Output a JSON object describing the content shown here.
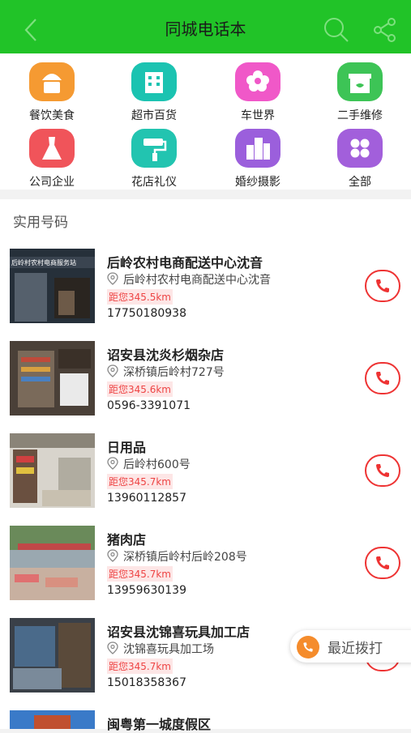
{
  "header": {
    "title": "同城电话本"
  },
  "categories": [
    {
      "label": "餐饮美食",
      "color": "#f59a32",
      "icon": "cupcake-icon"
    },
    {
      "label": "超市百货",
      "color": "#1bc3b1",
      "icon": "building-icon"
    },
    {
      "label": "车世界",
      "color": "#f058c8",
      "icon": "flower-icon"
    },
    {
      "label": "二手维修",
      "color": "#3dc456",
      "icon": "gift-icon"
    },
    {
      "label": "公司企业",
      "color": "#f0545a",
      "icon": "dress-icon"
    },
    {
      "label": "花店礼仪",
      "color": "#22c4b0",
      "icon": "paint-roller-icon"
    },
    {
      "label": "婚纱摄影",
      "color": "#9b5fdc",
      "icon": "city-icon"
    },
    {
      "label": "全部",
      "color": "#a25fdb",
      "icon": "grid-icon"
    }
  ],
  "section_title": "实用号码",
  "listings": [
    {
      "name": "后岭农村电商配送中心沈音",
      "address": "后岭村农村电商配送中心沈音",
      "distance": "距您345.5km",
      "phone": "17750180938",
      "sign": "后岭村农村电商服务站"
    },
    {
      "name": "诏安县沈炎杉烟杂店",
      "address": "深桥镇后岭村727号",
      "distance": "距您345.6km",
      "phone": "0596-3391071",
      "sign": ""
    },
    {
      "name": "日用品",
      "address": "后岭村600号",
      "distance": "距您345.7km",
      "phone": "13960112857",
      "sign": ""
    },
    {
      "name": "猪肉店",
      "address": "深桥镇后岭村后岭208号",
      "distance": "距您345.7km",
      "phone": "13959630139",
      "sign": ""
    },
    {
      "name": "诏安县沈锦喜玩具加工店",
      "address": "沈锦喜玩具加工场",
      "distance": "距您345.7km",
      "phone": "15018358367",
      "sign": ""
    },
    {
      "name": "闽粤第一城度假区",
      "address": "",
      "distance": "",
      "phone": "",
      "sign": ""
    }
  ],
  "floating_button": {
    "label": "最近拨打"
  }
}
